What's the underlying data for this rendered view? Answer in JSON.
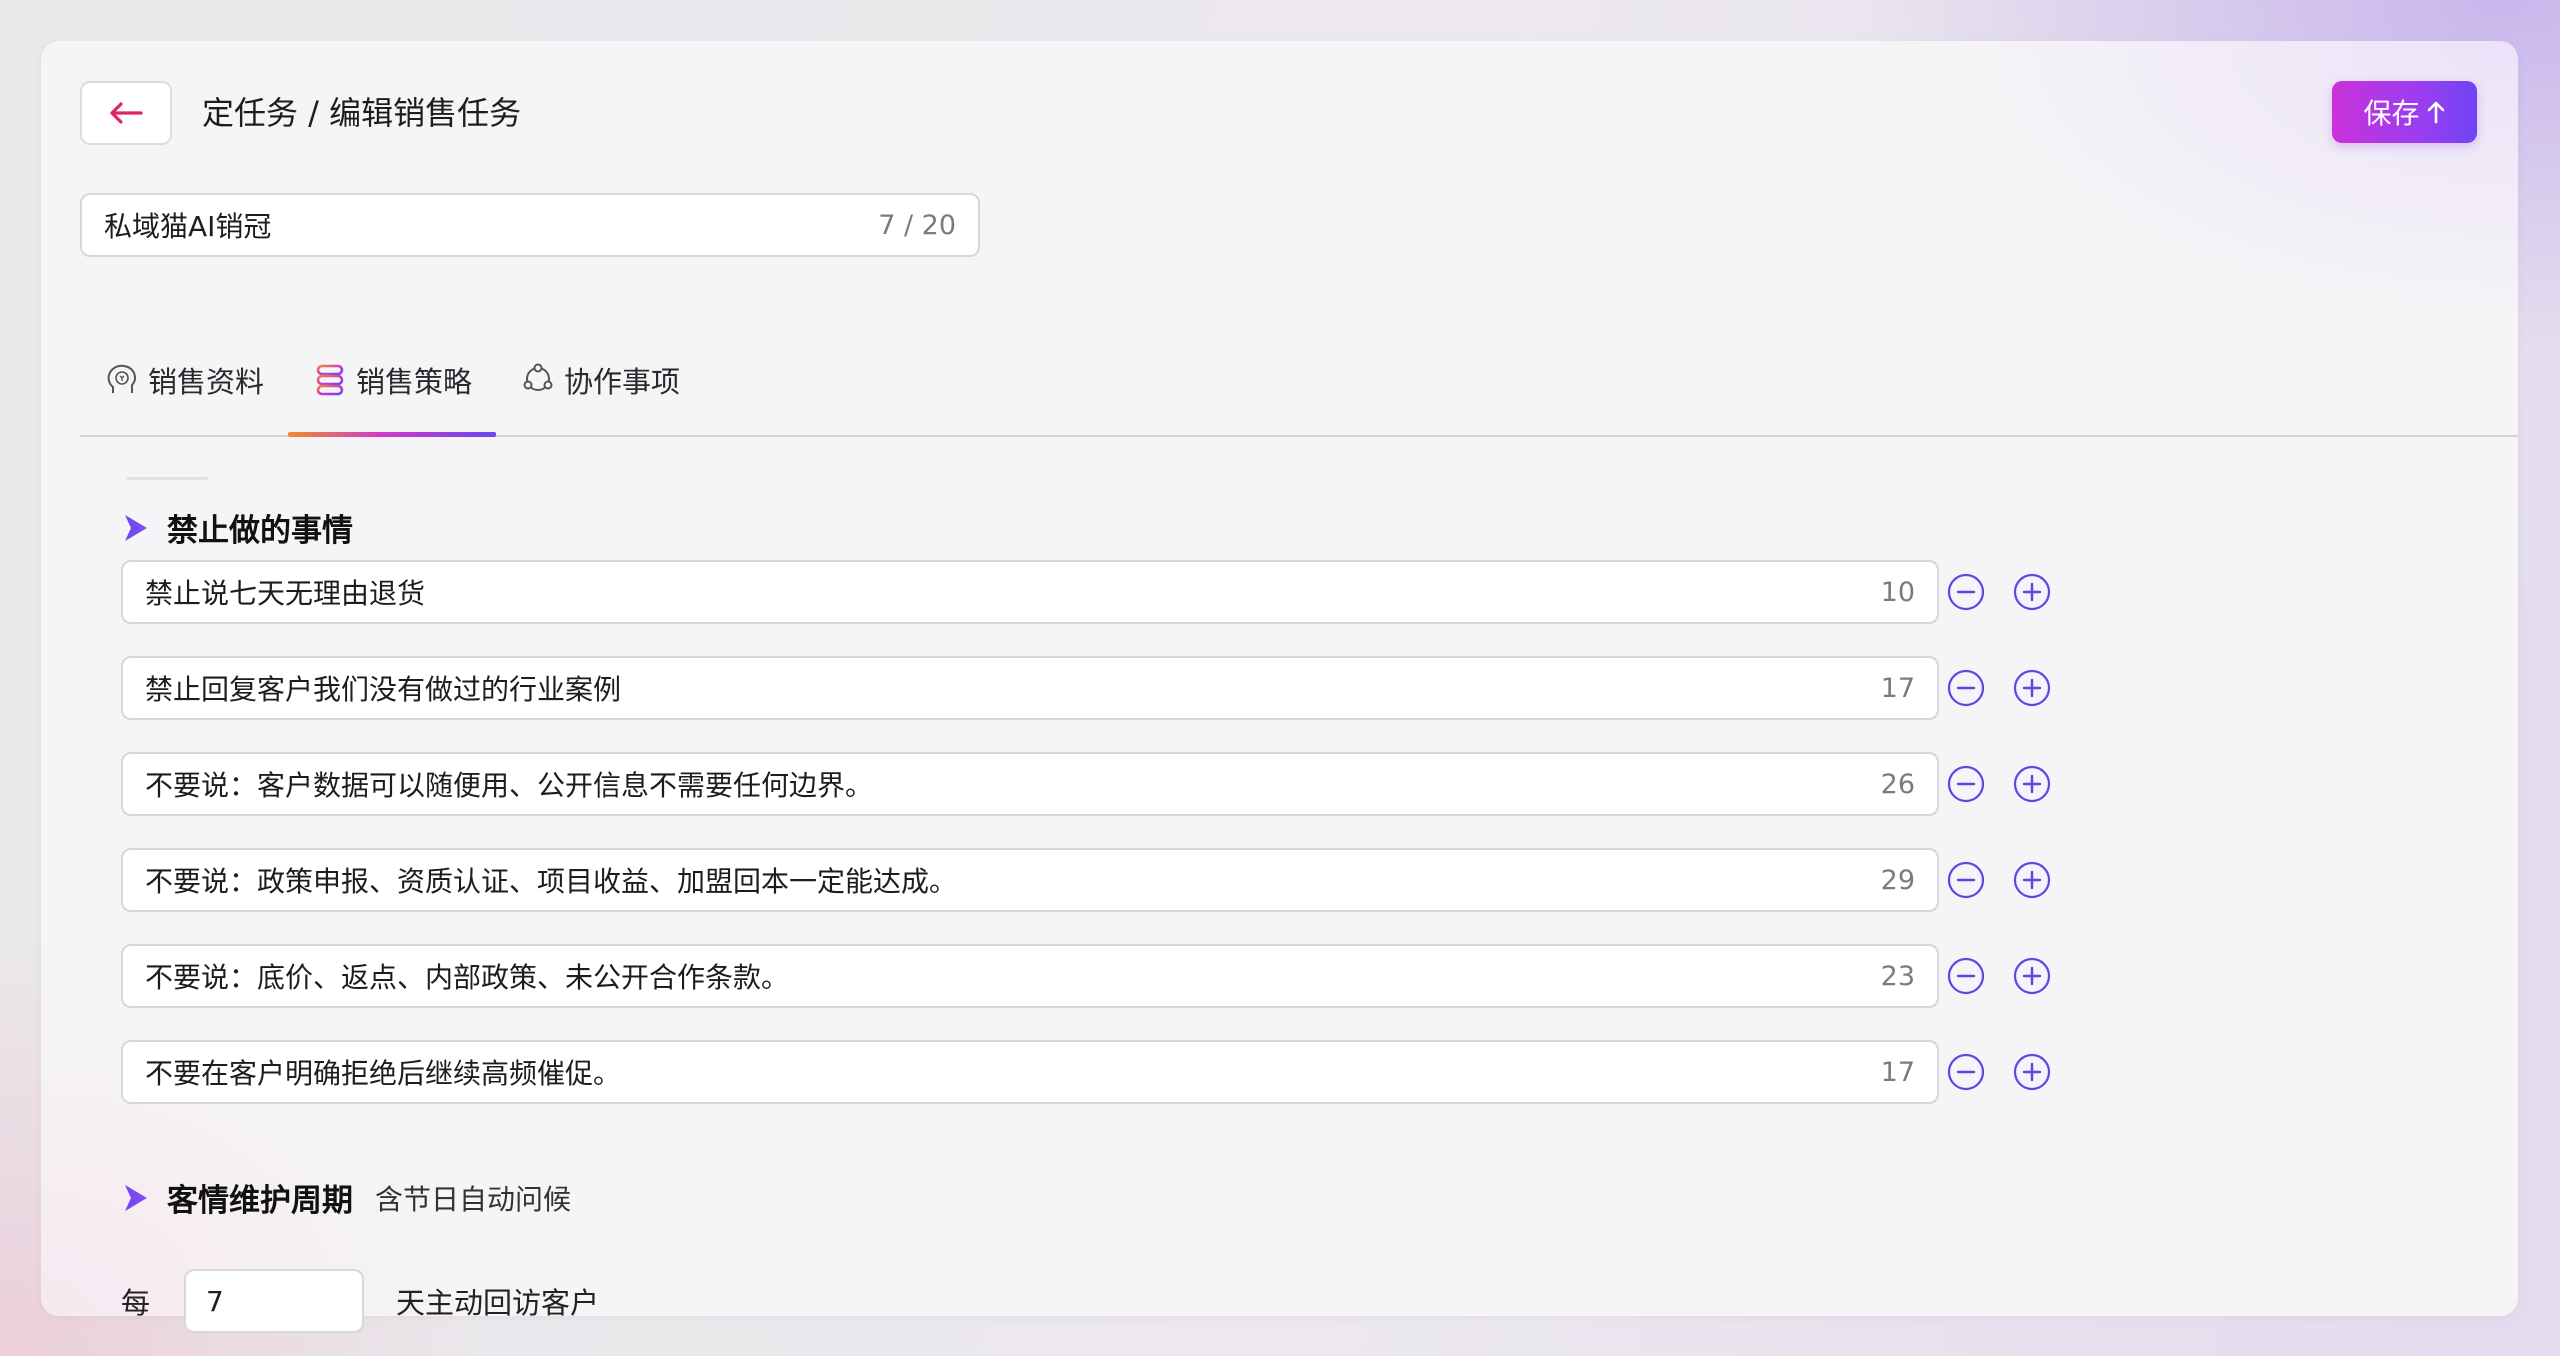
{
  "header": {
    "breadcrumb": "定任务 / 编辑销售任务",
    "save_label": "保存",
    "save_icon": "arrow-up-icon",
    "back_icon": "arrow-left-icon",
    "colors": {
      "accent_start": "#c932d9",
      "accent_end": "#6f44f3",
      "back_arrow": "#e0245e"
    }
  },
  "task": {
    "name_value": "私域猫AI销冠",
    "name_counter": "7 / 20"
  },
  "tabs": [
    {
      "label": "销售资料",
      "icon": "profile-head-icon",
      "active": false
    },
    {
      "label": "销售策略",
      "icon": "strategy-path-icon",
      "active": true
    },
    {
      "label": "协作事项",
      "icon": "collaboration-icon",
      "active": false
    }
  ],
  "forbidden": {
    "title": "禁止做的事情",
    "items": [
      {
        "text": "禁止说七天无理由退货",
        "count": "10"
      },
      {
        "text": "禁止回复客户我们没有做过的行业案例",
        "count": "17"
      },
      {
        "text": "不要说：客户数据可以随便用、公开信息不需要任何边界。",
        "count": "26"
      },
      {
        "text": "不要说：政策申报、资质认证、项目收益、加盟回本一定能达成。",
        "count": "29"
      },
      {
        "text": "不要说：底价、返点、内部政策、未公开合作条款。",
        "count": "23"
      },
      {
        "text": "不要在客户明确拒绝后继续高频催促。",
        "count": "17"
      }
    ]
  },
  "maintenance": {
    "title": "客情维护周期",
    "subtitle": "含节日自动问候",
    "prefix": "每",
    "days_value": "7",
    "suffix": "天主动回访客户"
  }
}
